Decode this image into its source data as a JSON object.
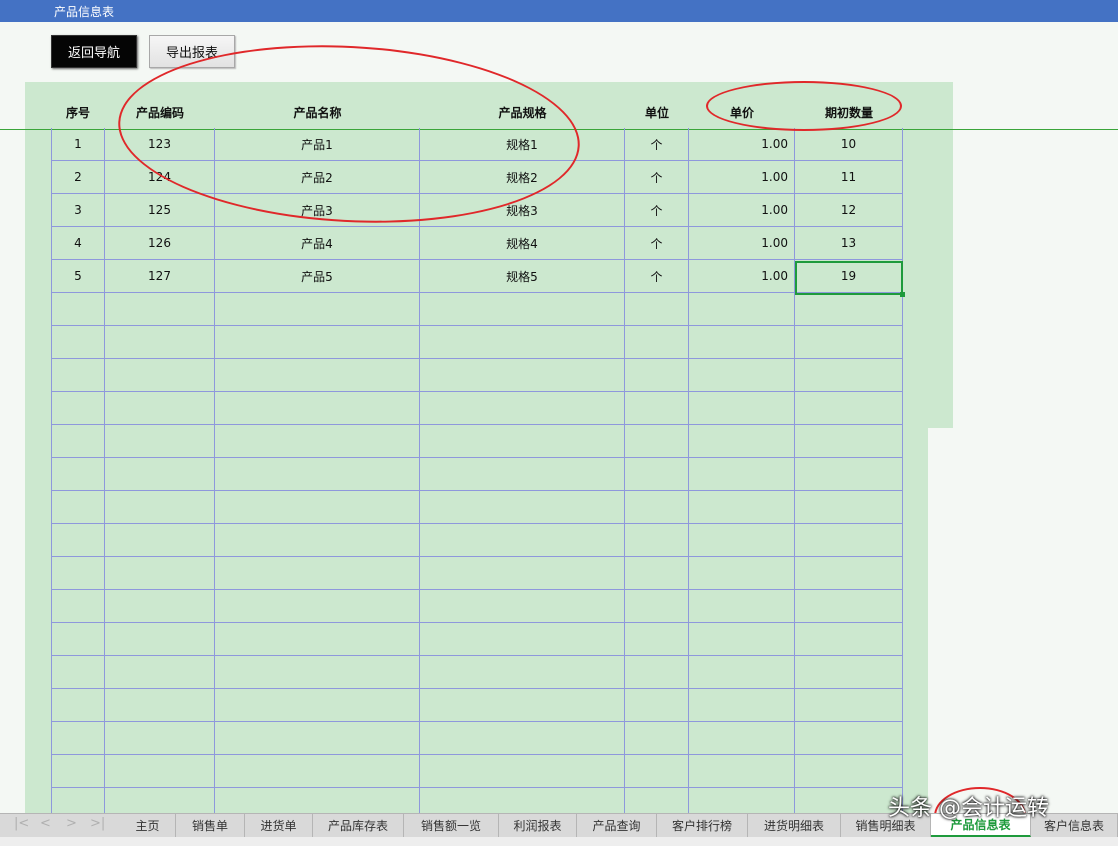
{
  "window": {
    "title": "产品信息表"
  },
  "toolbar": {
    "back_label": "返回导航",
    "export_label": "导出报表"
  },
  "table": {
    "headers": [
      "序号",
      "产品编码",
      "产品名称",
      "产品规格",
      "单位",
      "单价",
      "期初数量"
    ],
    "rows": [
      [
        "1",
        "123",
        "产品1",
        "规格1",
        "个",
        "1.00",
        "10"
      ],
      [
        "2",
        "124",
        "产品2",
        "规格2",
        "个",
        "1.00",
        "11"
      ],
      [
        "3",
        "125",
        "产品3",
        "规格3",
        "个",
        "1.00",
        "12"
      ],
      [
        "4",
        "126",
        "产品4",
        "规格4",
        "个",
        "1.00",
        "13"
      ],
      [
        "5",
        "127",
        "产品5",
        "规格5",
        "个",
        "1.00",
        "19"
      ]
    ],
    "empty_row_count": 16,
    "selected_cell": {
      "row": 4,
      "column": 6
    }
  },
  "sheet_tabs": {
    "nav_arrows": [
      "|<",
      "<",
      ">",
      ">|"
    ],
    "items": [
      "主页",
      "销售单",
      "进货单",
      "产品库存表",
      "销售额一览",
      "利润报表",
      "产品查询",
      "客户排行榜",
      "进货明细表",
      "销售明细表",
      "产品信息表",
      "客户信息表"
    ],
    "active_index": 10
  },
  "watermark": {
    "text": "头条 @会计运转"
  },
  "colors": {
    "title_bar": "#4472c4",
    "sheet_background": "#cce8cf",
    "grid_line": "#8e98dc",
    "selection": "#1e9a3c",
    "annotation": "#e0282a"
  }
}
